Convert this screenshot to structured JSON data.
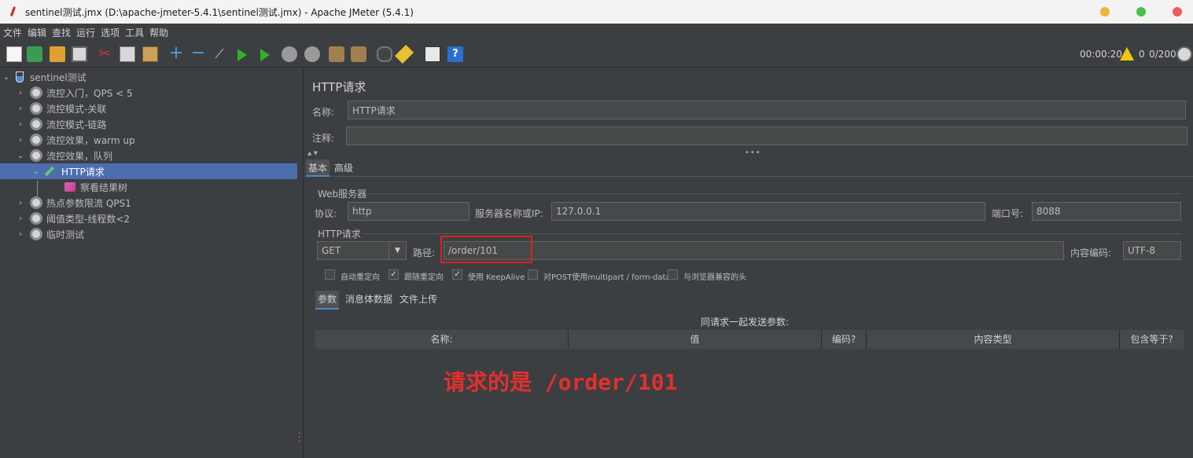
{
  "window": {
    "title": "sentinel测试.jmx (D:\\apache-jmeter-5.4.1\\sentinel测试.jmx) - Apache JMeter (5.4.1)"
  },
  "menu": [
    "文件",
    "编辑",
    "查找",
    "运行",
    "选项",
    "工具",
    "帮助"
  ],
  "toolbar": {
    "elapsed": "00:00:20",
    "warning_count": "0",
    "threads": "0/200",
    "icons": [
      "new-icon",
      "templates-icon",
      "open-icon",
      "save-icon",
      "cut-icon",
      "copy-icon",
      "paste-icon",
      "expand-icon",
      "collapse-icon",
      "toggle-icon",
      "start-icon",
      "start-no-timers-icon",
      "stop-icon",
      "shutdown-icon",
      "clear-icon",
      "clear-all-icon",
      "search-icon",
      "reset-search-icon",
      "function-helper-icon",
      "help-icon"
    ]
  },
  "tree": {
    "root": "sentinel测试",
    "items": [
      {
        "label": "流控入门，QPS < 5"
      },
      {
        "label": "流控模式-关联"
      },
      {
        "label": "流控模式-链路"
      },
      {
        "label": "流控效果，warm up"
      },
      {
        "label": "流控效果，队列"
      },
      {
        "label": "HTTP请求"
      },
      {
        "label": "察看结果树"
      },
      {
        "label": "热点参数限流 QPS1"
      },
      {
        "label": "阈值类型-线程数<2"
      },
      {
        "label": "临时测试"
      }
    ]
  },
  "panel": {
    "title": "HTTP请求",
    "name_label": "名称:",
    "name_value": "HTTP请求",
    "comment_label": "注释:",
    "comment_value": "",
    "tabs": [
      "基本",
      "高级"
    ],
    "web_server": {
      "group_title": "Web服务器",
      "protocol_label": "协议:",
      "protocol_value": "http",
      "server_label": "服务器名称或IP:",
      "server_value": "127.0.0.1",
      "port_label": "端口号:",
      "port_value": "8088"
    },
    "http_request": {
      "group_title": "HTTP请求",
      "method": "GET",
      "path_label": "路径:",
      "path_value": "/order/101",
      "encoding_label": "内容编码:",
      "encoding_value": "UTF-8"
    },
    "checkboxes": [
      {
        "label": "自动重定向",
        "checked": false
      },
      {
        "label": "跟随重定向",
        "checked": true
      },
      {
        "label": "使用 KeepAlive",
        "checked": true
      },
      {
        "label": "对POST使用multipart / form-data",
        "checked": false
      },
      {
        "label": "与浏览器兼容的头",
        "checked": false
      }
    ],
    "subtabs": [
      "参数",
      "消息体数据",
      "文件上传"
    ],
    "params_caption": "同请求一起发送参数:",
    "columns": [
      "名称:",
      "值",
      "编码?",
      "内容类型",
      "包含等于?"
    ]
  },
  "annotation": "请求的是 /order/101",
  "colors": {
    "accent": "#4b6eaf",
    "annotation": "#e52e2e",
    "background": "#3c3f41"
  }
}
